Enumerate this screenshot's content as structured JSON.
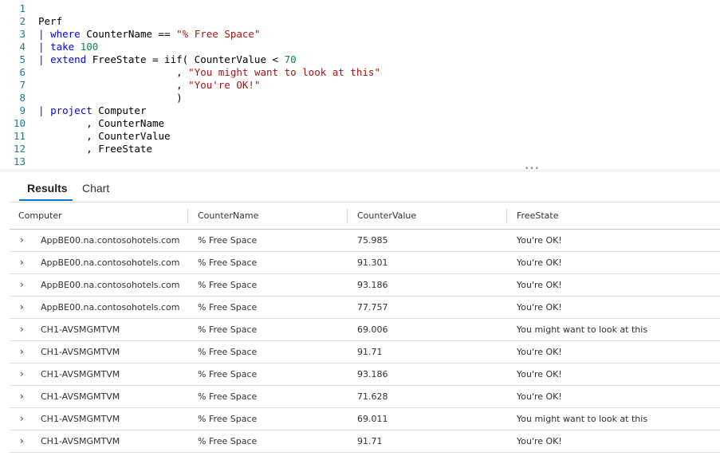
{
  "editor": {
    "lines": [
      {
        "num": "1",
        "segments": []
      },
      {
        "num": "2",
        "segments": [
          {
            "t": "Perf",
            "c": "plain"
          }
        ]
      },
      {
        "num": "3",
        "segments": [
          {
            "t": "| ",
            "c": "pipe"
          },
          {
            "t": "where",
            "c": "kw"
          },
          {
            "t": " CounterName == ",
            "c": "plain"
          },
          {
            "t": "\"% Free Space\"",
            "c": "str"
          }
        ]
      },
      {
        "num": "4",
        "segments": [
          {
            "t": "| ",
            "c": "pipe"
          },
          {
            "t": "take",
            "c": "kw"
          },
          {
            "t": " ",
            "c": "plain"
          },
          {
            "t": "100",
            "c": "num"
          }
        ]
      },
      {
        "num": "5",
        "segments": [
          {
            "t": "| ",
            "c": "pipe"
          },
          {
            "t": "extend",
            "c": "kw"
          },
          {
            "t": " FreeState = iif( CounterValue < ",
            "c": "plain"
          },
          {
            "t": "70",
            "c": "num"
          }
        ]
      },
      {
        "num": "6",
        "segments": [
          {
            "t": "                       , ",
            "c": "plain"
          },
          {
            "t": "\"You might want to look at this\"",
            "c": "str"
          }
        ]
      },
      {
        "num": "7",
        "segments": [
          {
            "t": "                       , ",
            "c": "plain"
          },
          {
            "t": "\"You're OK!\"",
            "c": "str"
          }
        ]
      },
      {
        "num": "8",
        "segments": [
          {
            "t": "                       )",
            "c": "plain"
          }
        ]
      },
      {
        "num": "9",
        "segments": [
          {
            "t": "| ",
            "c": "pipe"
          },
          {
            "t": "project",
            "c": "kw"
          },
          {
            "t": " Computer",
            "c": "plain"
          }
        ]
      },
      {
        "num": "10",
        "segments": [
          {
            "t": "        , CounterName",
            "c": "plain"
          }
        ]
      },
      {
        "num": "11",
        "segments": [
          {
            "t": "        , CounterValue",
            "c": "plain"
          }
        ]
      },
      {
        "num": "12",
        "segments": [
          {
            "t": "        , FreeState",
            "c": "plain"
          }
        ]
      },
      {
        "num": "13",
        "segments": []
      }
    ],
    "grip": "•••"
  },
  "tabs": {
    "results": "Results",
    "chart": "Chart"
  },
  "table": {
    "columns": [
      "Computer",
      "CounterName",
      "CounterValue",
      "FreeState"
    ],
    "expand_glyph": "›",
    "rows": [
      [
        "AppBE00.na.contosohotels.com",
        "% Free Space",
        "75.985",
        "You're OK!"
      ],
      [
        "AppBE00.na.contosohotels.com",
        "% Free Space",
        "91.301",
        "You're OK!"
      ],
      [
        "AppBE00.na.contosohotels.com",
        "% Free Space",
        "93.186",
        "You're OK!"
      ],
      [
        "AppBE00.na.contosohotels.com",
        "% Free Space",
        "77.757",
        "You're OK!"
      ],
      [
        "CH1-AVSMGMTVM",
        "% Free Space",
        "69.006",
        "You might want to look at this"
      ],
      [
        "CH1-AVSMGMTVM",
        "% Free Space",
        "91.71",
        "You're OK!"
      ],
      [
        "CH1-AVSMGMTVM",
        "% Free Space",
        "93.186",
        "You're OK!"
      ],
      [
        "CH1-AVSMGMTVM",
        "% Free Space",
        "71.628",
        "You're OK!"
      ],
      [
        "CH1-AVSMGMTVM",
        "% Free Space",
        "69.011",
        "You might want to look at this"
      ],
      [
        "CH1-AVSMGMTVM",
        "% Free Space",
        "91.71",
        "You're OK!"
      ]
    ]
  }
}
